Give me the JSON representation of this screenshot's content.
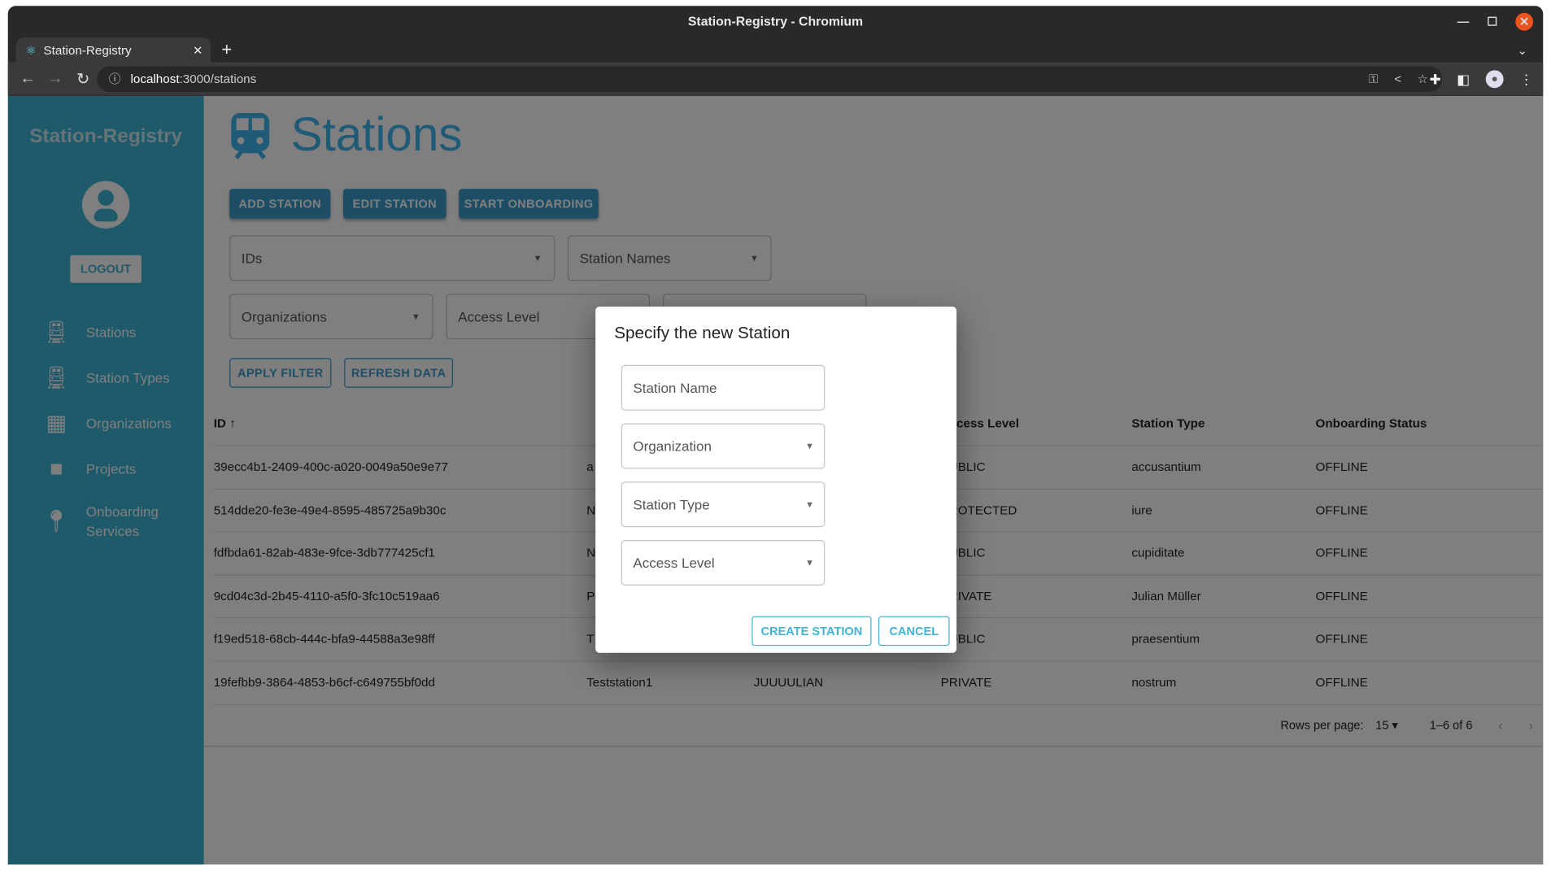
{
  "browser": {
    "window_title": "Station-Registry - Chromium",
    "tab_title": "Station-Registry",
    "url_host": "localhost",
    "url_rest": ":3000/stations"
  },
  "sidebar": {
    "brand": "Station-Registry",
    "logout": "LOGOUT",
    "items": [
      {
        "label": "Stations",
        "icon": "train-icon"
      },
      {
        "label": "Station Types",
        "icon": "train-alert-icon"
      },
      {
        "label": "Organizations",
        "icon": "building-icon"
      },
      {
        "label": "Projects",
        "icon": "briefcase-icon"
      },
      {
        "label": "Onboarding",
        "label2": "Services",
        "icon": "map-marker-plus-icon"
      }
    ]
  },
  "main": {
    "title": "Stations",
    "buttons": {
      "add": "ADD STATION",
      "edit": "EDIT STATION",
      "onboard": "START ONBOARDING",
      "apply": "APPLY FILTER",
      "refresh": "REFRESH DATA"
    },
    "filters": {
      "ids": "IDs",
      "names": "Station Names",
      "orgs": "Organizations",
      "access": "Access Level"
    },
    "table": {
      "headers": {
        "id": "ID",
        "access": "Access Level",
        "type": "Station Type",
        "status": "Onboarding Status"
      },
      "rows": [
        {
          "id": "39ecc4b1-2409-400c-a020-0049a50e9e77",
          "name": "a",
          "org": "",
          "access": "PUBLIC",
          "type": "accusantium",
          "status": "OFFLINE"
        },
        {
          "id": "514dde20-fe3e-49e4-8595-485725a9b30c",
          "name": "N",
          "org": "",
          "access": "PROTECTED",
          "type": "iure",
          "status": "OFFLINE"
        },
        {
          "id": "fdfbda61-82ab-483e-9fce-3db777425cf1",
          "name": "N",
          "org": "",
          "access": "PUBLIC",
          "type": "cupiditate",
          "status": "OFFLINE"
        },
        {
          "id": "9cd04c3d-2b45-4110-a5f0-3fc10c519aa6",
          "name": "P",
          "org": "",
          "access": "PRIVATE",
          "type": "Julian Müller",
          "status": "OFFLINE"
        },
        {
          "id": "f19ed518-68cb-444c-bfa9-44588a3e98ff",
          "name": "T",
          "org": "",
          "access": "PUBLIC",
          "type": "praesentium",
          "status": "OFFLINE"
        },
        {
          "id": "19fefbb9-3864-4853-b6cf-c649755bf0dd",
          "name": "Teststation1",
          "org": "JUUUULIAN",
          "access": "PRIVATE",
          "type": "nostrum",
          "status": "OFFLINE"
        }
      ]
    },
    "pager": {
      "rows_label": "Rows per page:",
      "rows_value": "15",
      "range": "1–6 of 6"
    }
  },
  "dialog": {
    "title": "Specify the new Station",
    "station_name": "Station Name",
    "organization": "Organization",
    "station_type": "Station Type",
    "access_level": "Access Level",
    "create": "CREATE STATION",
    "cancel": "CANCEL"
  },
  "colors": {
    "sidebar": "#3fb4d6",
    "primary": "#3a9ccc",
    "accent": "#3fb4d6",
    "close": "#e9541f"
  }
}
